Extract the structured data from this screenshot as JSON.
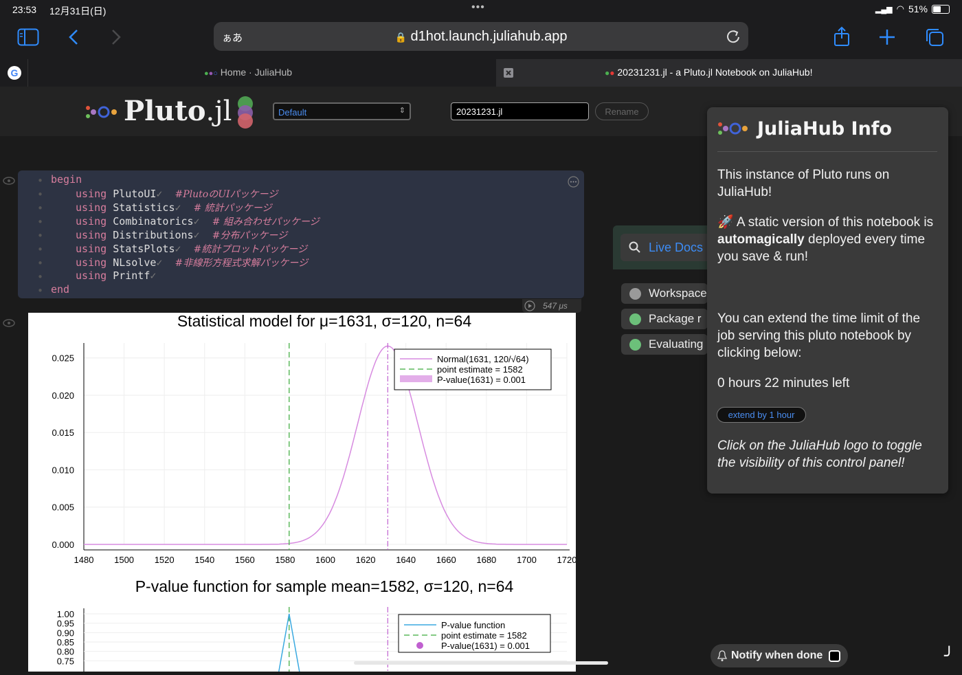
{
  "status_bar": {
    "time": "23:53",
    "date": "12月31日(日)",
    "battery": "51%",
    "battery_level": 0.51
  },
  "toolbar": {
    "input_mode": "ぁあ",
    "url": "d1hot.launch.juliahub.app"
  },
  "tabs": [
    {
      "title": "Home · JuliaHub"
    },
    {
      "title": "20231231.jl - a Pluto.jl Notebook on JuliaHub!"
    }
  ],
  "pluto": {
    "logo_text": "Pluto",
    "logo_suffix": ".jl",
    "theme_select": "Default",
    "filename": "20231231.jl",
    "rename_label": "Rename"
  },
  "code": {
    "begin": "begin",
    "end": "end",
    "using": "using",
    "lines": [
      {
        "pkg": "PlutoUI",
        "comment": "#PlutoのUIパッケージ"
      },
      {
        "pkg": "Statistics",
        "comment": "# 統計パッケージ"
      },
      {
        "pkg": "Combinatorics",
        "comment": "# 組み合わせパッケージ"
      },
      {
        "pkg": "Distributions",
        "comment": "#分布パッケージ"
      },
      {
        "pkg": "StatsPlots",
        "comment": "#統計プロットパッケージ"
      },
      {
        "pkg": "NLsolve",
        "comment": "#非線形方程式求解パッケージ"
      },
      {
        "pkg": "Printf",
        "comment": ""
      }
    ],
    "runtime": "547 μs"
  },
  "side": {
    "live_docs": "Live Docs",
    "status_items": [
      {
        "label": "Workspace",
        "color": "#9a9a9a"
      },
      {
        "label": "Package r",
        "color": "#6cc07a"
      },
      {
        "label": "Evaluating",
        "color": "#6cc07a"
      }
    ]
  },
  "juliahub": {
    "title": "JuliaHub Info",
    "intro": "This instance of Pluto runs on JuliaHub!",
    "static_prefix": "🚀 A static version of this notebook is ",
    "static_bold": "automagically",
    "static_suffix": " deployed every time you save & run!",
    "extend_text": "You can extend the time limit of the job serving this pluto notebook by clicking below:",
    "time_left": "0 hours 22 minutes left",
    "extend_button": "extend by 1 hour",
    "toggle_hint": "Click on the JuliaHub logo to toggle the visibility of this control panel!"
  },
  "notify": {
    "label": "Notify when done"
  },
  "chart_data": [
    {
      "type": "line",
      "title": "Statistical model for μ=1631, σ=120, n=64",
      "xlim": [
        1480,
        1720
      ],
      "ylim": [
        0,
        0.027
      ],
      "xticks": [
        1480,
        1500,
        1520,
        1540,
        1560,
        1580,
        1600,
        1620,
        1640,
        1660,
        1680,
        1700,
        1720
      ],
      "yticks": [
        "0.000",
        "0.005",
        "0.010",
        "0.015",
        "0.020",
        "0.025"
      ],
      "yticks_values": [
        0,
        0.005,
        0.01,
        0.015,
        0.02,
        0.025
      ],
      "series": [
        {
          "name": "Normal(1631, 120/√64)",
          "mean": 1631,
          "sd": 15,
          "color": "#d78be0"
        },
        {
          "name": "point estimate = 1582",
          "vline": 1582,
          "color": "#5cb85c"
        },
        {
          "name": "P-value(1631) = 0.001",
          "vline": 1631,
          "color": "#c060d0"
        }
      ],
      "legend": "top-right",
      "grid": true
    },
    {
      "type": "line",
      "title": "P-value function for sample mean=1582, σ=120, n=64",
      "xlim": [
        1480,
        1720
      ],
      "ylim": [
        0.7,
        1.0
      ],
      "yticks": [
        "1.00",
        "0.95",
        "0.90",
        "0.85",
        "0.80",
        "0.75"
      ],
      "yticks_values": [
        1.0,
        0.95,
        0.9,
        0.85,
        0.8,
        0.75
      ],
      "series": [
        {
          "name": "P-value function",
          "peak": 1582,
          "color": "#3aa9e0"
        },
        {
          "name": "point estimate = 1582",
          "vline": 1582,
          "color": "#5cb85c"
        },
        {
          "name": "P-value(1631) = 0.001",
          "vline": 1631,
          "color": "#c060d0"
        }
      ],
      "legend": "top-right",
      "grid": true
    }
  ]
}
